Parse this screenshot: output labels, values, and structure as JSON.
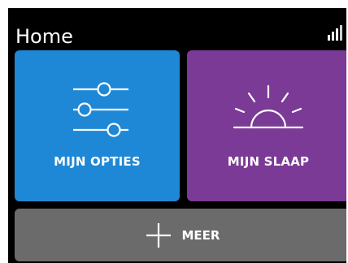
{
  "header": {
    "title": "Home",
    "signal_icon": "signal-strength-icon"
  },
  "tiles": {
    "options": {
      "label": "MIJN OPTIES",
      "icon": "sliders-icon",
      "color": "#1e88d6"
    },
    "sleep": {
      "label": "MIJN SLAAP",
      "icon": "sunrise-icon",
      "color": "#7b3a96"
    },
    "more": {
      "label": "MEER",
      "icon": "plus-icon",
      "color": "#6b6b6b"
    }
  }
}
